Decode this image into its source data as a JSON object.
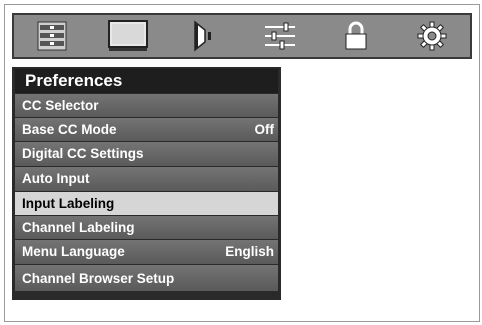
{
  "toolbar": {
    "icons": [
      "setup-list-icon",
      "picture-icon",
      "audio-speaker-icon",
      "equalizer-sliders-icon",
      "lock-icon",
      "gear-icon"
    ]
  },
  "menu": {
    "title": "Preferences",
    "items": [
      {
        "label": "CC Selector",
        "value": ""
      },
      {
        "label": "Base CC Mode",
        "value": "Off"
      },
      {
        "label": "Digital CC Settings",
        "value": ""
      },
      {
        "label": "Auto Input",
        "value": ""
      },
      {
        "label": "Input Labeling",
        "value": "",
        "selected": true
      },
      {
        "label": "Channel Labeling",
        "value": ""
      },
      {
        "label": "Menu Language",
        "value": "English"
      },
      {
        "label": "Channel Browser Setup",
        "value": ""
      }
    ]
  },
  "colors": {
    "toolbar_bg": "#8a8a8a",
    "menu_bg": "#2a2a2a",
    "item_bg": "#666666",
    "selected_bg": "#d6d6d6"
  }
}
